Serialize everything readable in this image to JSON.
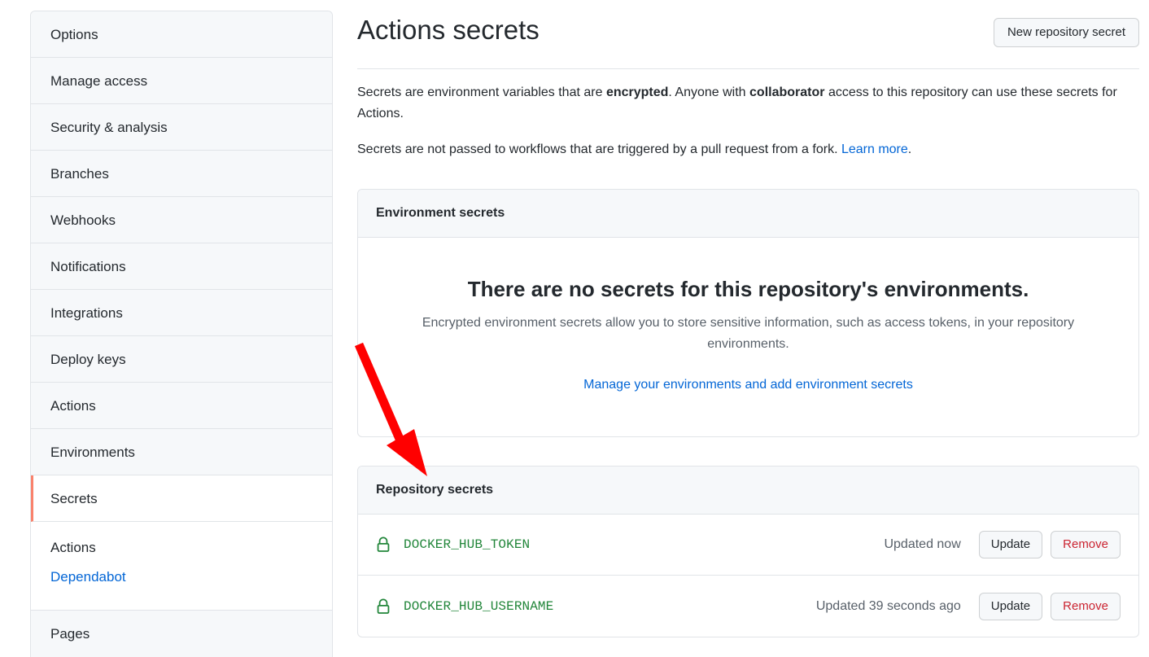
{
  "sidebar": {
    "items": [
      {
        "label": "Options",
        "selected": false
      },
      {
        "label": "Manage access",
        "selected": false
      },
      {
        "label": "Security & analysis",
        "selected": false
      },
      {
        "label": "Branches",
        "selected": false
      },
      {
        "label": "Webhooks",
        "selected": false
      },
      {
        "label": "Notifications",
        "selected": false
      },
      {
        "label": "Integrations",
        "selected": false
      },
      {
        "label": "Deploy keys",
        "selected": false
      },
      {
        "label": "Actions",
        "selected": false
      },
      {
        "label": "Environments",
        "selected": false
      },
      {
        "label": "Secrets",
        "selected": true
      }
    ],
    "subnav": [
      {
        "label": "Actions",
        "is_link": false
      },
      {
        "label": "Dependabot",
        "is_link": true
      }
    ],
    "trailing_items": [
      {
        "label": "Pages",
        "selected": false
      }
    ]
  },
  "header": {
    "title": "Actions secrets",
    "new_secret_button": "New repository secret"
  },
  "description": {
    "line1_part1": "Secrets are environment variables that are ",
    "line1_bold1": "encrypted",
    "line1_part2": ". Anyone with ",
    "line1_bold2": "collaborator",
    "line1_part3": " access to this repository can use these secrets for Actions.",
    "line2_text": "Secrets are not passed to workflows that are triggered by a pull request from a fork. ",
    "line2_link": "Learn more",
    "line2_suffix": "."
  },
  "environment_secrets": {
    "header": "Environment secrets",
    "empty_title": "There are no secrets for this repository's environments.",
    "empty_text": "Encrypted environment secrets allow you to store sensitive information, such as access tokens, in your repository environments.",
    "empty_action": "Manage your environments and add environment secrets"
  },
  "repository_secrets": {
    "header": "Repository secrets",
    "rows": [
      {
        "icon": "lock-icon",
        "name": "DOCKER_HUB_TOKEN",
        "updated": "Updated now",
        "update_label": "Update",
        "remove_label": "Remove"
      },
      {
        "icon": "lock-icon",
        "name": "DOCKER_HUB_USERNAME",
        "updated": "Updated 39 seconds ago",
        "update_label": "Update",
        "remove_label": "Remove"
      }
    ]
  },
  "annotation": {
    "type": "arrow",
    "color": "#ff0000"
  },
  "colors": {
    "accent_link": "#0366d6",
    "secret_green": "#22863a",
    "danger_red": "#cb2431",
    "selected_bar": "#f9826c",
    "muted_text": "#586069",
    "panel_bg": "#f6f8fa",
    "border": "#e1e4e8",
    "annotation_red": "#ff0000"
  }
}
